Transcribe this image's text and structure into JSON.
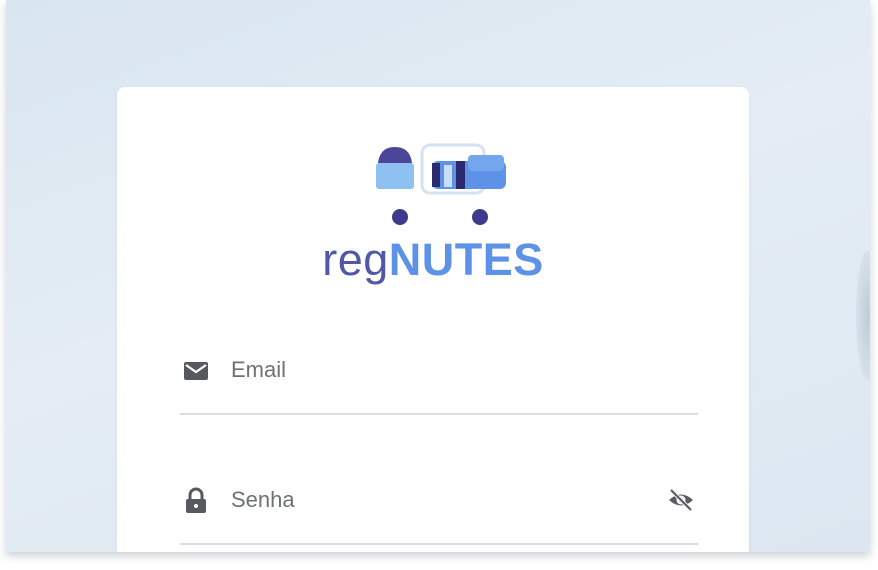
{
  "brand": {
    "prefix": "reg",
    "name": "NUTES"
  },
  "login_form": {
    "email": {
      "placeholder": "Email",
      "value": "",
      "icon": "mail-icon"
    },
    "password": {
      "placeholder": "Senha",
      "value": "",
      "icon": "lock-icon",
      "toggle_icon": "eye-off-icon"
    }
  },
  "colors": {
    "background": "#dfe9f2",
    "card": "#ffffff",
    "brand_reg": "#5157a9",
    "brand_nutes": "#5d92e6",
    "logo_dark": "#3f3a8c",
    "logo_light": "#8fc0f2",
    "underline": "#d9dce1"
  }
}
